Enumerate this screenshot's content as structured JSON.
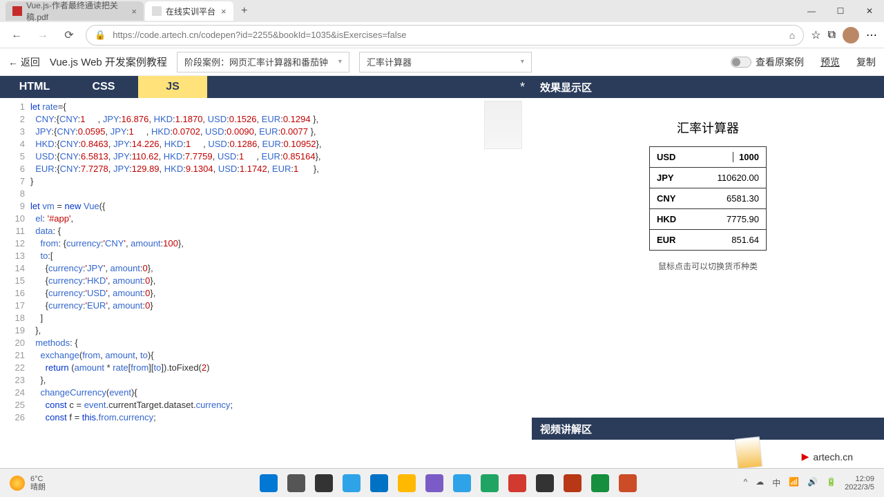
{
  "browser": {
    "tabs": [
      {
        "title": "Vue.js-作者最终通读把关稿.pdf",
        "active": false
      },
      {
        "title": "在线实训平台",
        "active": true
      }
    ],
    "url": "https://code.artech.cn/codepen?id=2255&bookId=1035&isExercises=false"
  },
  "app_header": {
    "back": "← 返回",
    "course": "Vue.js Web 开发案例教程",
    "dropdown1": "阶段案例：网页汇率计算器和番茄钟",
    "dropdown2": "汇率计算器",
    "see_answer": "查看原案例",
    "preview": "预览",
    "copy": "复制"
  },
  "editor": {
    "tabs": {
      "html": "HTML",
      "css": "CSS",
      "js": "JS",
      "active": "JS"
    },
    "effect_header": "效果显示区",
    "video_header": "视频讲解区",
    "line_numbers": [
      "1",
      "2",
      "3",
      "4",
      "5",
      "6",
      "7",
      "8",
      "9",
      "10",
      "11",
      "12",
      "13",
      "14",
      "15",
      "16",
      "17",
      "18",
      "19",
      "20",
      "21",
      "22",
      "23",
      "24",
      "25",
      "26"
    ],
    "code_lines": [
      "let rate={",
      "  CNY:{CNY:1     , JPY:16.876, HKD:1.1870, USD:0.1526, EUR:0.1294 },",
      "  JPY:{CNY:0.0595, JPY:1     , HKD:0.0702, USD:0.0090, EUR:0.0077 },",
      "  HKD:{CNY:0.8463, JPY:14.226, HKD:1     , USD:0.1286, EUR:0.10952},",
      "  USD:{CNY:6.5813, JPY:110.62, HKD:7.7759, USD:1     , EUR:0.85164},",
      "  EUR:{CNY:7.7278, JPY:129.89, HKD:9.1304, USD:1.1742, EUR:1      },",
      "}",
      "",
      "let vm = new Vue({",
      "  el: '#app',",
      "  data: {",
      "    from: {currency:'CNY', amount:100},",
      "    to:[",
      "      {currency:'JPY', amount:0},",
      "      {currency:'HKD', amount:0},",
      "      {currency:'USD', amount:0},",
      "      {currency:'EUR', amount:0}",
      "    ]",
      "  },",
      "  methods: {",
      "    exchange(from, amount, to){",
      "      return (amount * rate[from][to]).toFixed(2)",
      "    },",
      "    changeCurrency(event){",
      "      const c = event.currentTarget.dataset.currency;",
      "      const f = this.from.currency;"
    ]
  },
  "preview": {
    "title": "汇率计算器",
    "rows": [
      {
        "cur": "USD",
        "val": "1000",
        "input": true
      },
      {
        "cur": "JPY",
        "val": "110620.00"
      },
      {
        "cur": "CNY",
        "val": "6581.30"
      },
      {
        "cur": "HKD",
        "val": "7775.90"
      },
      {
        "cur": "EUR",
        "val": "851.64"
      }
    ],
    "hint": "鼠标点击可以切换货币种类"
  },
  "watermark": {
    "text": "artech.cn"
  },
  "taskbar": {
    "weather_temp": "6°C",
    "weather_desc": "晴朗",
    "time": "12:09",
    "date": "2022/3/5",
    "icon_colors": [
      "#0078d4",
      "#555",
      "#333",
      "#2ea3e8",
      "#0072c6",
      "#ffb900",
      "#7b5cc6",
      "#2ea3e8",
      "#1fa463",
      "#d23a2f",
      "#333",
      "#b83816",
      "#168f3e",
      "#cb4c27"
    ]
  }
}
